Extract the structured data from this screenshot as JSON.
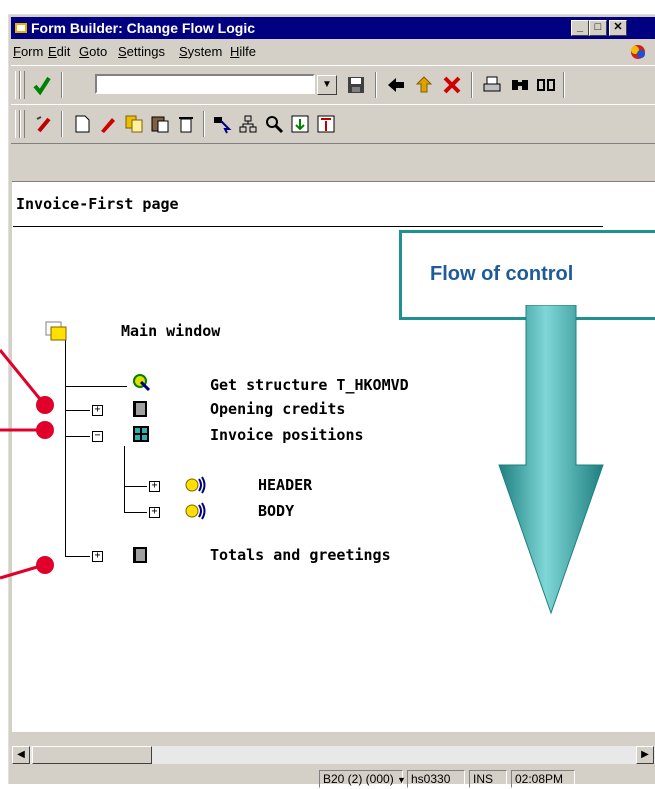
{
  "window": {
    "title": "Form Builder: Change Flow Logic",
    "buttons": {
      "minimize": "_",
      "maximize": "□",
      "close": "✕"
    }
  },
  "menu": [
    "Form",
    "Edit",
    "Goto",
    "Settings",
    "System",
    "Hilfe"
  ],
  "command_field": {
    "value": ""
  },
  "page_title": "Invoice-First page",
  "tree": {
    "root": "Main window",
    "items": [
      {
        "label": "Get structure T_HKOMVD",
        "icon": "program-lines-icon"
      },
      {
        "label": "Opening credits",
        "icon": "window-icon",
        "toggle": "+"
      },
      {
        "label": "Invoice positions",
        "icon": "table-icon",
        "toggle": "−"
      },
      {
        "label": "HEADER",
        "icon": "text-node-icon",
        "toggle": "+"
      },
      {
        "label": "BODY",
        "icon": "text-node-icon",
        "toggle": "+"
      },
      {
        "label": "Totals and greetings",
        "icon": "window-icon",
        "toggle": "+"
      }
    ]
  },
  "callout": {
    "text": "Flow of control"
  },
  "status": {
    "system": "B20 (2) (000)",
    "server": "hs0330",
    "mode": "INS",
    "time": "02:08PM"
  },
  "colors": {
    "titlebar": "#000080",
    "window": "#d4d0c8",
    "callout_border": "#1e9191",
    "callout_text": "#1f5b9a",
    "arrow": "#2aa3a3",
    "marker": "#e0002a"
  }
}
